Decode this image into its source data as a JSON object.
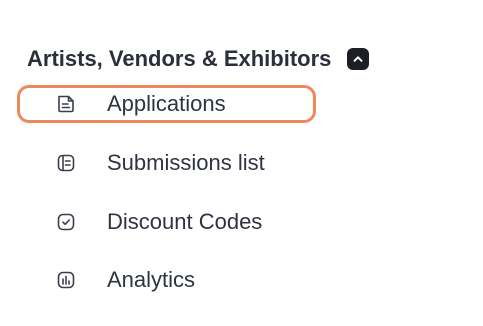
{
  "section": {
    "title": "Artists, Vendors & Exhibitors",
    "collapse_icon": "chevron-up-icon"
  },
  "nav": {
    "items": [
      {
        "label": "Applications",
        "icon": "document-icon",
        "active": true
      },
      {
        "label": "Submissions list",
        "icon": "list-icon",
        "active": false
      },
      {
        "label": "Discount Codes",
        "icon": "check-badge-icon",
        "active": false
      },
      {
        "label": "Analytics",
        "icon": "bar-chart-icon",
        "active": false
      }
    ]
  },
  "colors": {
    "highlight_border": "#f0885e",
    "text": "#2f3440",
    "header_text": "#2a2f3a",
    "button_bg": "#1c1f26"
  }
}
